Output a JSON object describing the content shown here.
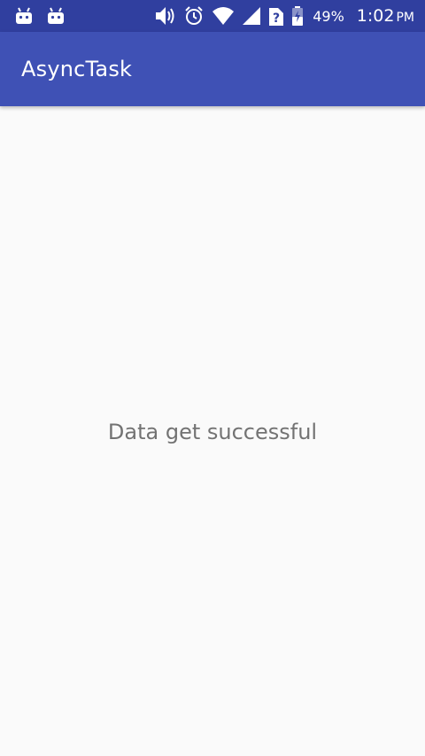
{
  "status_bar": {
    "notifications": [
      "android-icon",
      "android-icon"
    ],
    "system_icons": [
      "volume-icon",
      "alarm-icon",
      "wifi-icon",
      "cell-signal-icon",
      "no-sim-icon",
      "battery-icon"
    ],
    "battery_percent": "49%",
    "time": "1:02",
    "ampm": "PM"
  },
  "app_bar": {
    "title": "AsyncTask"
  },
  "main": {
    "message": "Data get successful"
  },
  "colors": {
    "status_bar": "#303f9f",
    "app_bar": "#3f51b5",
    "background": "#fafafa",
    "message_text": "#737373"
  }
}
